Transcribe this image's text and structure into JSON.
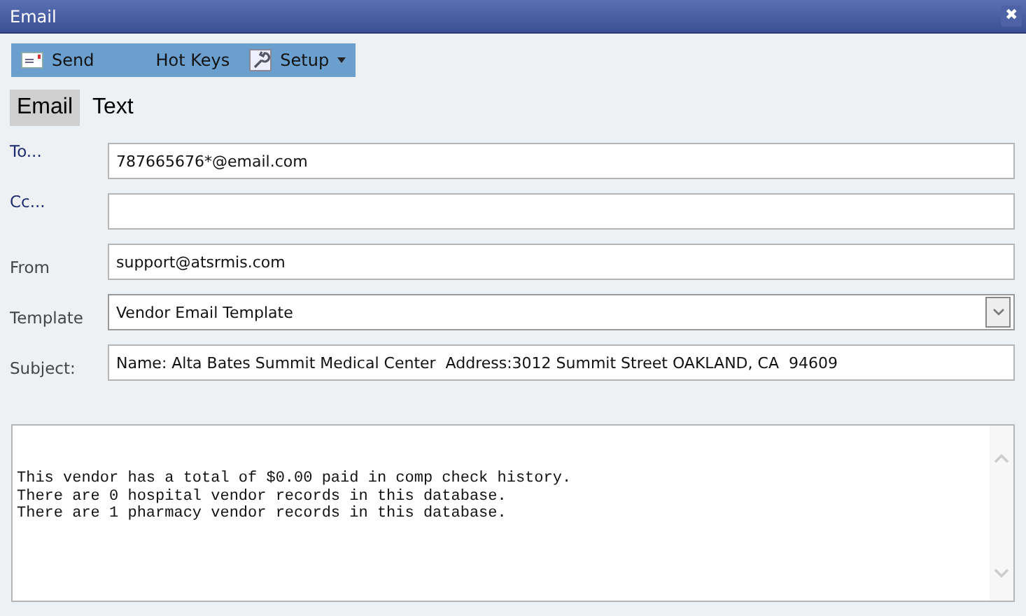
{
  "window": {
    "title": "Email",
    "close": "✖"
  },
  "toolbar": [
    {
      "label": "Send",
      "kind": "send"
    },
    {
      "label": "Hot Keys",
      "kind": "plain"
    },
    {
      "label": "Setup",
      "kind": "menu"
    }
  ],
  "tabs": [
    {
      "label": "Email",
      "selected": true
    },
    {
      "label": "Text",
      "selected": false
    }
  ],
  "fields": [
    {
      "label": "To...",
      "kind": "recipient",
      "value": "787665676*@email.com"
    },
    {
      "label": "Cc...",
      "kind": "recipient"
    },
    {
      "label": "From",
      "kind": "text",
      "value": "support@atsrmis.com"
    },
    {
      "label": "Template",
      "kind": "select",
      "value": "Vendor Email Template"
    },
    {
      "label": "Subject:",
      "kind": "text",
      "value": "Name: Alta Bates Summit Medical Center  Address:3012 Summit Street OAKLAND, CA  94609"
    }
  ],
  "body": {
    "lines": [
      "This vendor has a total of $0.00 paid in comp check history.",
      "There are 0 hospital vendor records in this database.",
      "There are 1 pharmacy vendor records in this database."
    ]
  }
}
